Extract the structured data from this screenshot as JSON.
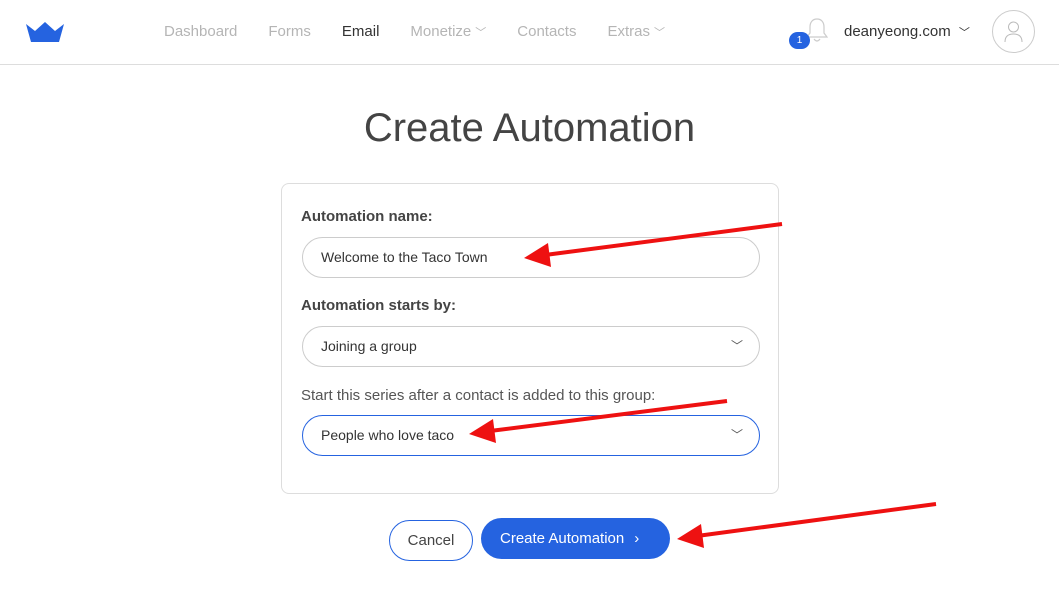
{
  "nav": {
    "items": [
      {
        "label": "Dashboard"
      },
      {
        "label": "Forms"
      },
      {
        "label": "Email",
        "active": true
      },
      {
        "label": "Monetize",
        "dropdown": true
      },
      {
        "label": "Contacts"
      },
      {
        "label": "Extras",
        "dropdown": true
      }
    ],
    "notifications": "1",
    "account": "deanyeong.com",
    "brand_color": "#2563e0"
  },
  "page": {
    "title": "Create Automation"
  },
  "form": {
    "name_label": "Automation name:",
    "name_value": "Welcome to the Taco Town",
    "starts_label": "Automation starts by:",
    "starts_value": "Joining a group",
    "group_label": "Start this series after a contact is added to this group:",
    "group_value": "People who love taco"
  },
  "actions": {
    "cancel": "Cancel",
    "create": "Create Automation"
  },
  "annotation_color": "#ff0000"
}
